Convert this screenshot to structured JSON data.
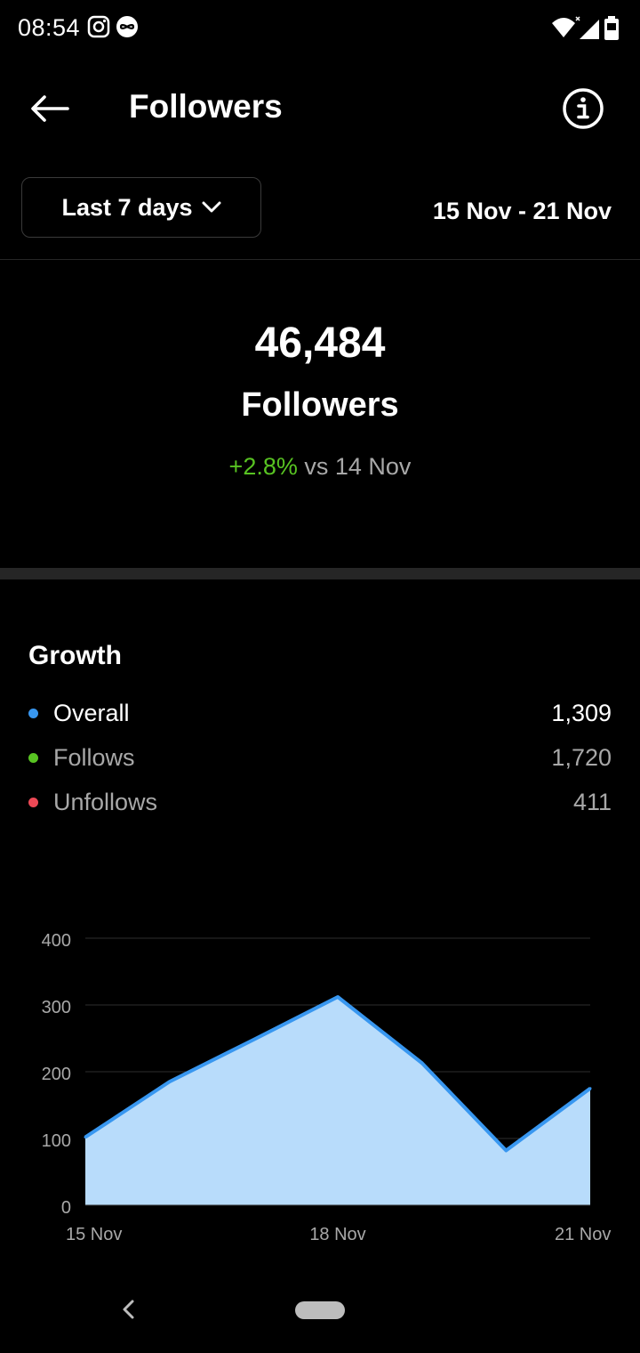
{
  "status_bar": {
    "time": "08:54",
    "icons": [
      "instagram-icon",
      "infinity-icon",
      "wifi-icon",
      "signal-icon",
      "battery-icon"
    ]
  },
  "header": {
    "title": "Followers",
    "back_icon": "arrow-left-icon",
    "info_icon": "info-icon"
  },
  "filter": {
    "range_label": "Last 7 days",
    "range_icon": "chevron-down-icon",
    "date_range": "15 Nov - 21 Nov"
  },
  "summary": {
    "count": "46,484",
    "label": "Followers",
    "change_pct": "+2.8%",
    "change_suffix": "vs 14 Nov"
  },
  "growth": {
    "title": "Growth",
    "legend": [
      {
        "label": "Overall",
        "value": "1,309",
        "color": "#3897f0",
        "text_color": "#ffffff"
      },
      {
        "label": "Follows",
        "value": "1,720",
        "color": "#58c322",
        "text_color": "#a8a8a8"
      },
      {
        "label": "Unfollows",
        "value": "411",
        "color": "#ed4956",
        "text_color": "#a8a8a8"
      }
    ]
  },
  "chart_data": {
    "type": "area",
    "x": [
      "15 Nov",
      "16 Nov",
      "17 Nov",
      "18 Nov",
      "19 Nov",
      "20 Nov",
      "21 Nov"
    ],
    "x_tick_labels": [
      "15 Nov",
      "18 Nov",
      "21 Nov"
    ],
    "series": [
      {
        "name": "Overall",
        "values": [
          102,
          185,
          248,
          312,
          213,
          82,
          175
        ],
        "color": "#3897f0",
        "fill": "#b8dcfb"
      }
    ],
    "yticks": [
      0,
      100,
      200,
      300,
      400
    ],
    "ylim": [
      0,
      400
    ],
    "grid": true
  },
  "nav": {
    "back_icon": "nav-back-icon",
    "home_icon": "home-pill-icon"
  }
}
